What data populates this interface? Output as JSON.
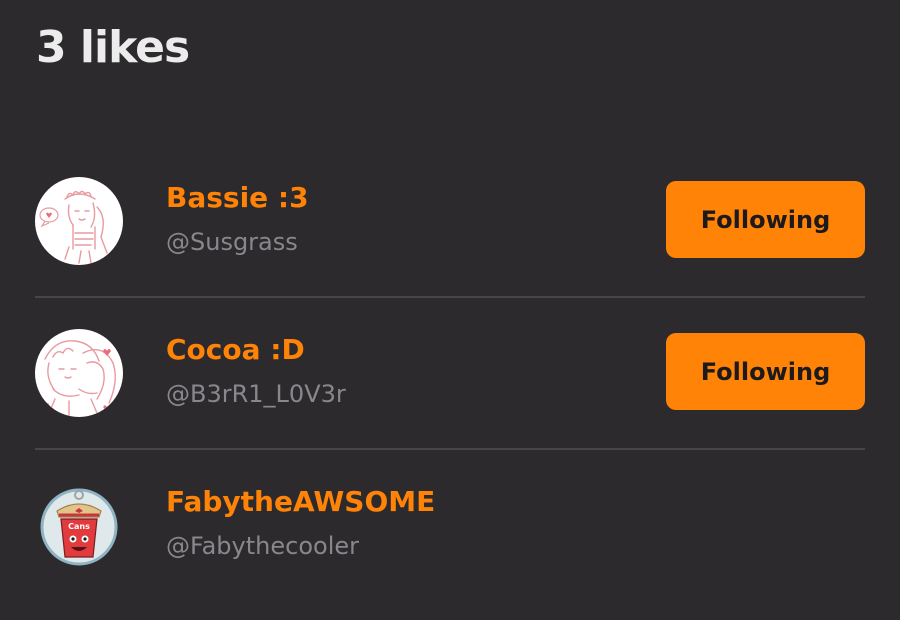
{
  "header": {
    "title": "3 likes"
  },
  "colors": {
    "background": "#2d2a2e",
    "accent": "#ff8306",
    "handle": "#8a878c",
    "title": "#ececec"
  },
  "likers": [
    {
      "name": "Bassie :3",
      "handle": "@Susgrass",
      "button_label": "Following",
      "avatar_icon": "anime-sketch-avatar-icon"
    },
    {
      "name": "Cocoa :D",
      "handle": "@B3rR1_L0V3r",
      "button_label": "Following",
      "avatar_icon": "anime-sketch-avatar-icon"
    },
    {
      "name": "FabytheAWSOME",
      "handle": "@Fabythecooler",
      "button_label": "",
      "avatar_icon": "cartoon-cup-avatar-icon"
    }
  ]
}
